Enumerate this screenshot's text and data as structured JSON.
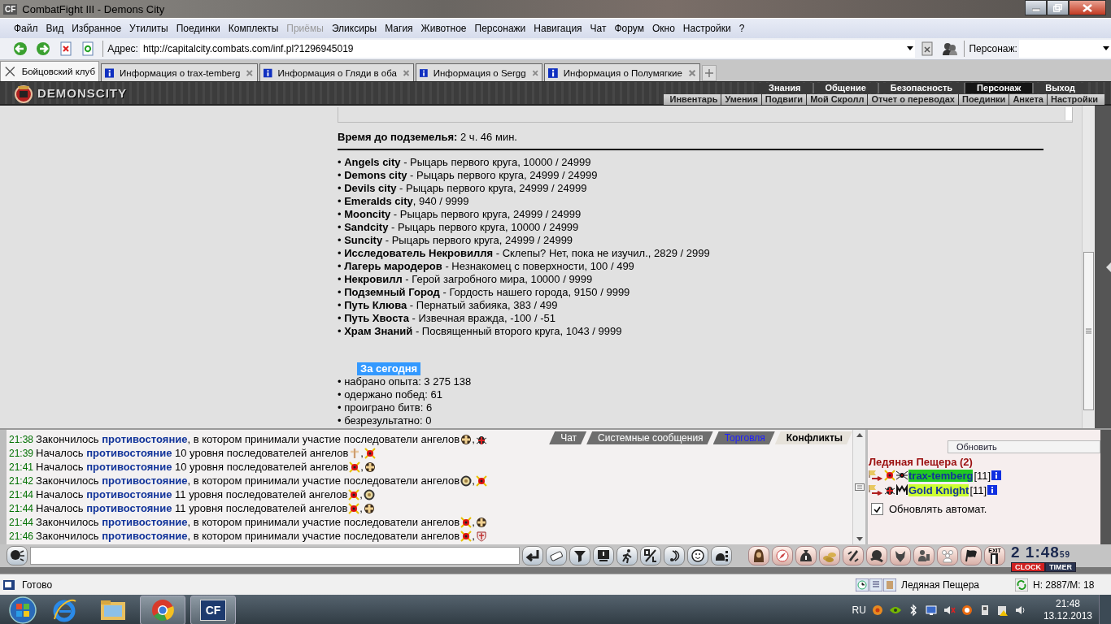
{
  "window": {
    "icon_text": "CF",
    "title": "CombatFight III - Demons City"
  },
  "menu": [
    {
      "label": "Файл",
      "disabled": false
    },
    {
      "label": "Вид",
      "disabled": false
    },
    {
      "label": "Избранное",
      "disabled": false
    },
    {
      "label": "Утилиты",
      "disabled": false
    },
    {
      "label": "Поединки",
      "disabled": false
    },
    {
      "label": "Комплекты",
      "disabled": false
    },
    {
      "label": "Приёмы",
      "disabled": true
    },
    {
      "label": "Эликсиры",
      "disabled": false
    },
    {
      "label": "Магия",
      "disabled": false
    },
    {
      "label": "Животное",
      "disabled": false
    },
    {
      "label": "Персонажи",
      "disabled": false
    },
    {
      "label": "Навигация",
      "disabled": false
    },
    {
      "label": "Чат",
      "disabled": false
    },
    {
      "label": "Форум",
      "disabled": false
    },
    {
      "label": "Окно",
      "disabled": false
    },
    {
      "label": "Настройки",
      "disabled": false
    },
    {
      "label": "?",
      "disabled": false
    }
  ],
  "address_bar": {
    "label": "Адрес:",
    "value": "http://capitalcity.combats.com/inf.pl?1296945019",
    "character_label": "Персонаж:"
  },
  "tabs": [
    {
      "label": "Бойцовский клуб",
      "selected": true,
      "kind": "home"
    },
    {
      "label": "Информация о trax-temberg",
      "selected": false,
      "kind": "info"
    },
    {
      "label": "Информация о Гляди в оба",
      "selected": false,
      "kind": "info"
    },
    {
      "label": "Информация о Sergg",
      "selected": false,
      "kind": "info"
    },
    {
      "label": "Информация о Полумягкие",
      "selected": false,
      "kind": "info"
    }
  ],
  "game_header": {
    "logo": "DEMONSCITY",
    "top_nav": [
      {
        "label": "Знания",
        "selected": false
      },
      {
        "label": "Общение",
        "selected": false
      },
      {
        "label": "Безопасность",
        "selected": false
      },
      {
        "label": "Персонаж",
        "selected": true
      },
      {
        "label": "Выход",
        "selected": false
      }
    ],
    "sub_nav": [
      "Инвентарь",
      "Умения",
      "Подвиги",
      "Мой Скролл",
      "Отчет о переводах",
      "Поединки",
      "Анкета",
      "Настройки"
    ]
  },
  "info": {
    "dungeon_label": "Время до подземелья:",
    "dungeon_value": "2 ч. 46 мин.",
    "reputations": [
      "• **Angels city** - Рыцарь первого круга, 10000 / 24999",
      "• **Demons city** - Рыцарь первого круга, 24999 / 24999",
      "• **Devils city** - Рыцарь первого круга, 24999 / 24999",
      "• **Emeralds city**, 940 / 9999",
      "• **Mooncity** - Рыцарь первого круга, 24999 / 24999",
      "• **Sandcity** - Рыцарь первого круга, 10000 / 24999",
      "• **Suncity** - Рыцарь первого круга, 24999 / 24999",
      "• **Исследователь Некровилля** - Склепы? Нет, пока не изучил., 2829 / 2999",
      "• **Лагерь мародеров** - Незнакомец с поверхности, 100 / 499",
      "• **Некровилл** - Герой загробного мира, 10000 / 9999",
      "• **Подземный Город** - Гордость нашего города, 9150 / 9999",
      "• **Путь Клюва** - Пернатый забияка, 383 / 499",
      "• **Путь Хвоста** - Извечная вражда, -100 / -51",
      "• **Храм Знаний** - Посвященный второго круга, 1043 / 9999"
    ],
    "today_heading": "За сегодня",
    "today_stats": [
      "• набрано опыта: 3 275 138",
      "• одержано побед: 61",
      "• проиграно битв: 6",
      "• безрезультатно: 0"
    ]
  },
  "chat": {
    "emblem_separator": ",",
    "messages": [
      {
        "time": "21:38",
        "text": "Закончилось **противостояние**, в котором принимали участие последователи ангелов",
        "emblems": [
          {
            "kind": "cross"
          },
          {
            "kind": "bug"
          }
        ]
      },
      {
        "time": "21:39",
        "text": "Началось **противостояние** 10 уровня последователей ангелов",
        "emblems": [
          {
            "kind": "pale"
          },
          {
            "kind": "star"
          }
        ]
      },
      {
        "time": "21:41",
        "text": "Началось **противостояние** 10 уровня последователей ангелов",
        "emblems": [
          {
            "kind": "star"
          },
          {
            "kind": "cross"
          }
        ]
      },
      {
        "time": "21:42",
        "text": "Закончилось **противостояние**, в котором принимали участие последователи ангелов",
        "emblems": [
          {
            "kind": "wreath"
          },
          {
            "kind": "star"
          }
        ]
      },
      {
        "time": "21:44",
        "text": "Началось **противостояние** 11 уровня последователей ангелов",
        "emblems": [
          {
            "kind": "star"
          },
          {
            "kind": "wreath"
          }
        ]
      },
      {
        "time": "21:44",
        "text": "Началось **противостояние** 11 уровня последователей ангелов",
        "emblems": [
          {
            "kind": "star"
          },
          {
            "kind": "cross"
          }
        ]
      },
      {
        "time": "21:44",
        "text": "Закончилось **противостояние**, в котором принимали участие последователи ангелов",
        "emblems": [
          {
            "kind": "star"
          },
          {
            "kind": "cross"
          }
        ]
      },
      {
        "time": "21:46",
        "text": "Закончилось **противостояние**, в котором принимали участие последователи ангелов",
        "emblems": [
          {
            "kind": "star"
          },
          {
            "kind": "shield"
          }
        ]
      }
    ],
    "tabs": [
      {
        "label": "Чат",
        "selected": false,
        "unread": false
      },
      {
        "label": "Системные сообщения",
        "selected": false,
        "unread": false
      },
      {
        "label": "Торговля",
        "selected": false,
        "unread": true
      },
      {
        "label": "Конфликты",
        "selected": true,
        "unread": false
      }
    ]
  },
  "online": {
    "refresh_button": "Обновить",
    "location": "Ледяная Пещера (2)",
    "players": [
      {
        "name": "trax-temberg",
        "level": "[11]",
        "color": "#22c822",
        "emblems": [
          {
            "kind": "star"
          },
          {
            "kind": "spider"
          }
        ]
      },
      {
        "name": "Gold Knight",
        "level": "[11]",
        "color": "#ccff33",
        "emblems": [
          {
            "kind": "bug"
          },
          {
            "kind": "monogram"
          }
        ]
      }
    ],
    "auto_refresh": {
      "label": "Обновлять автомат.",
      "checked": true
    }
  },
  "input_bar": {
    "exit_label": "EXIT",
    "clock": "2 1:48",
    "seconds": "59",
    "clock_label": "CLOCK",
    "timer_label": "TIMER"
  },
  "status_bar": {
    "status": "Готово",
    "location": "Ледяная Пещера",
    "stats": "H: 2887/M: 18"
  },
  "taskbar": {
    "app_text": "CF",
    "language": "RU",
    "time": "21:48",
    "date": "13.12.2013"
  }
}
